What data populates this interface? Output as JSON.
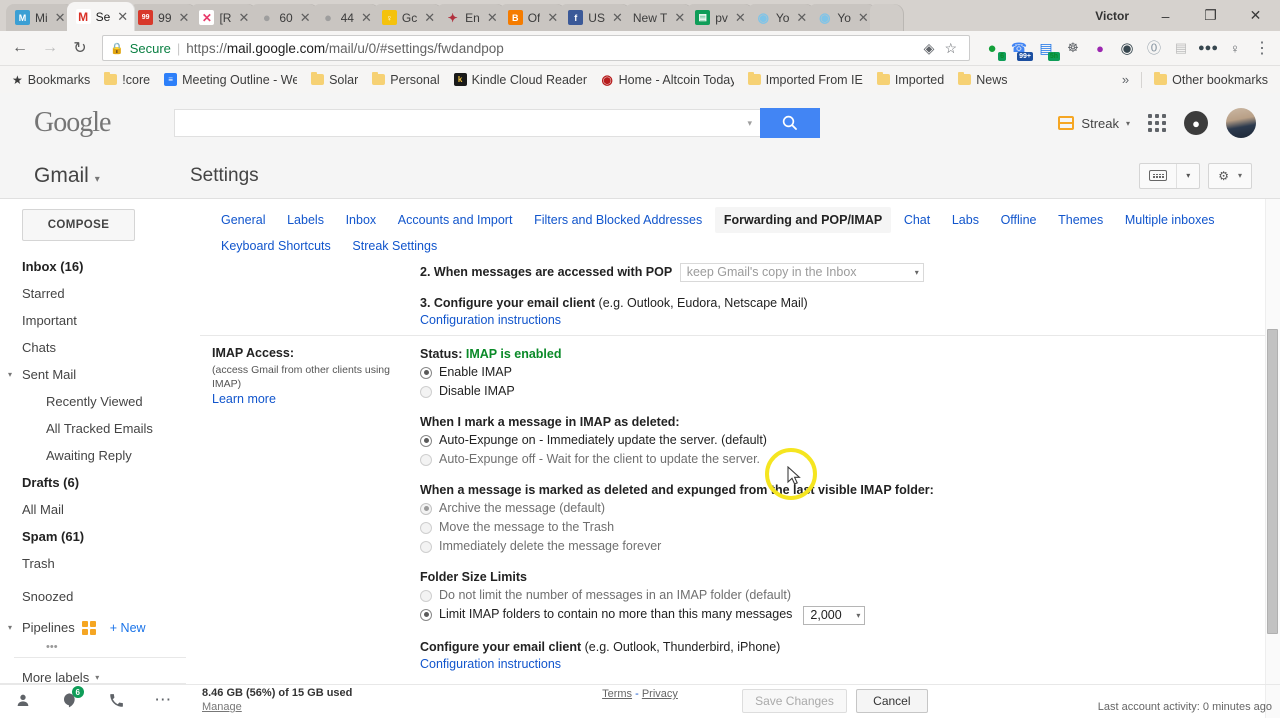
{
  "browser": {
    "tabs": [
      {
        "label": "Mi",
        "fav": "M",
        "favbg": "#3b9fd4",
        "active": false
      },
      {
        "label": "Se",
        "fav": "M",
        "favbg": "#ffffff",
        "favcolor": "#d93025",
        "active": true
      },
      {
        "label": "99",
        "fav": "99",
        "favbg": "#d8392b",
        "active": false
      },
      {
        "label": "[R",
        "fav": "X",
        "favbg": "#ffffff",
        "favcolor": "#e8396a",
        "active": false
      },
      {
        "label": "60",
        "fav": "●",
        "favbg": "#9e9e9e",
        "active": false
      },
      {
        "label": "44",
        "fav": "●",
        "favbg": "#9e9e9e",
        "active": false
      },
      {
        "label": "Gc",
        "fav": "♀",
        "favbg": "#f4c20d",
        "active": false
      },
      {
        "label": "En",
        "fav": "✦",
        "favbg": "#b1303d",
        "active": false
      },
      {
        "label": "Of",
        "fav": "B",
        "favbg": "#f57c00",
        "active": false
      },
      {
        "label": "US",
        "fav": "f",
        "favbg": "#3b5998",
        "active": false
      },
      {
        "label": "New T",
        "fav": "",
        "favbg": "transparent",
        "active": false
      },
      {
        "label": "pv",
        "fav": "▤",
        "favbg": "#0f9d58",
        "active": false
      },
      {
        "label": "Yo",
        "fav": "◉",
        "favbg": "#7fc4e8",
        "active": false
      },
      {
        "label": "Yo",
        "fav": "◉",
        "favbg": "#7fc4e8",
        "active": false
      }
    ],
    "window_user": "Victor",
    "window_minimize": "–",
    "window_maximize": "❐",
    "window_close": "✕",
    "nav": {
      "back_icon": "←",
      "forward_icon": "→",
      "reload_icon": "↻",
      "lock_icon": "🔒",
      "secure_label": "Secure",
      "url_prefix": "https://",
      "url_domain": "mail.google.com",
      "url_path": "/mail/u/0/#settings/fwdandpop",
      "url_full": "https://mail.google.com/mail/u/0/#settings/fwdandpop",
      "cast_icon": "◈",
      "star_icon": "☆",
      "menu_icon": "⋮"
    },
    "extensions": [
      {
        "name": "green-circle-extension",
        "glyph": "●",
        "color": "#14a03a",
        "badge": "6",
        "badgeclass": "green"
      },
      {
        "name": "phone-extension",
        "glyph": "✆",
        "color": "#4285f4",
        "badge": "99+",
        "badgeclass": "dark"
      },
      {
        "name": "blue-note-extension",
        "glyph": "▤",
        "color": "#1a73e8",
        "badge": "5h",
        "badgeclass": "green"
      },
      {
        "name": "swirl-extension",
        "glyph": "@",
        "color": "#5f6368",
        "badge": ""
      },
      {
        "name": "alert-extension",
        "glyph": "●",
        "color": "#9c27b0",
        "badge": ""
      },
      {
        "name": "eye-extension",
        "glyph": "◉",
        "color": "#37474f",
        "badge": ""
      },
      {
        "name": "skype-extension",
        "glyph": "S",
        "color": "#8d9aa5",
        "badge": ""
      },
      {
        "name": "list-extension",
        "glyph": "☰",
        "color": "#b0b0b0",
        "badge": ""
      },
      {
        "name": "dots-extension",
        "glyph": "•••",
        "color": "#37474f",
        "badge": ""
      },
      {
        "name": "bulb-extension",
        "glyph": "♀",
        "color": "#5f6368",
        "badge": ""
      }
    ],
    "bookmarks": {
      "bar_label": "Bookmarks",
      "items": [
        {
          "label": "!core",
          "type": "folder"
        },
        {
          "label": "Meeting Outline - We",
          "type": "icon",
          "glyph": "≡",
          "color": "#2d7ff9"
        },
        {
          "label": "Solar",
          "type": "folder"
        },
        {
          "label": "Personal",
          "type": "folder"
        },
        {
          "label": "Kindle Cloud Reader",
          "type": "icon",
          "glyph": "k",
          "color": "#1a1a1a"
        },
        {
          "label": "Home - Altcoin Today",
          "type": "icon",
          "glyph": "●",
          "color": "#b71c1c"
        },
        {
          "label": "Imported From IE",
          "type": "folder"
        },
        {
          "label": "Imported",
          "type": "folder"
        },
        {
          "label": "News",
          "type": "folder"
        }
      ],
      "overflow_icon": "»",
      "other_label": "Other bookmarks"
    }
  },
  "gmail": {
    "logo": "Google",
    "search_placeholder": "",
    "search_value": "",
    "search_dropdown_icon": "▾",
    "search_button_icon": "ᵌ",
    "streak_label": "Streak",
    "streak_caret": "▾",
    "notifications_icon": "bell",
    "apps_icon": "apps-grid",
    "gmail_menu_label": "Gmail",
    "gmail_menu_caret": "▾",
    "page_title": "Settings",
    "keyboard_button_caret": "▾",
    "gear_icon": "⚙",
    "gear_caret": "▾"
  },
  "sidebar": {
    "compose_label": "COMPOSE",
    "items": [
      {
        "label": "Inbox (16)",
        "bold": true,
        "indent": false
      },
      {
        "label": "Starred",
        "bold": false,
        "indent": false
      },
      {
        "label": "Important",
        "bold": false,
        "indent": false
      },
      {
        "label": "Chats",
        "bold": false,
        "indent": false
      },
      {
        "label": "Sent Mail",
        "bold": false,
        "indent": false,
        "arrow": "▾"
      },
      {
        "label": "Recently Viewed",
        "bold": false,
        "indent": true
      },
      {
        "label": "All Tracked Emails",
        "bold": false,
        "indent": true
      },
      {
        "label": "Awaiting Reply",
        "bold": false,
        "indent": true
      },
      {
        "label": "Drafts (6)",
        "bold": true,
        "indent": false
      },
      {
        "label": "All Mail",
        "bold": false,
        "indent": false
      },
      {
        "label": "Spam (61)",
        "bold": true,
        "indent": false
      },
      {
        "label": "Trash",
        "bold": false,
        "indent": false
      },
      {
        "label": "Snoozed",
        "bold": false,
        "indent": false
      }
    ],
    "pipelines_label": "Pipelines",
    "pipelines_arrow": "▾",
    "pipelines_new": "+ New",
    "more_labels": "More labels",
    "more_labels_caret": "▾",
    "tools": [
      {
        "name": "contacts-icon",
        "glyph": "●",
        "badge": ""
      },
      {
        "name": "hangouts-icon",
        "glyph": "●",
        "badge": "6"
      },
      {
        "name": "phone-icon",
        "glyph": "✆",
        "badge": ""
      },
      {
        "name": "more-icon",
        "glyph": "⋯",
        "badge": ""
      }
    ]
  },
  "settings": {
    "tabs": [
      {
        "label": "General",
        "active": false
      },
      {
        "label": "Labels",
        "active": false
      },
      {
        "label": "Inbox",
        "active": false
      },
      {
        "label": "Accounts and Import",
        "active": false
      },
      {
        "label": "Filters and Blocked Addresses",
        "active": false
      },
      {
        "label": "Forwarding and POP/IMAP",
        "active": true
      },
      {
        "label": "Chat",
        "active": false
      },
      {
        "label": "Labs",
        "active": false
      },
      {
        "label": "Offline",
        "active": false
      },
      {
        "label": "Themes",
        "active": false
      },
      {
        "label": "Multiple inboxes",
        "active": false
      },
      {
        "label": "Keyboard Shortcuts",
        "active": false
      },
      {
        "label": "Streak Settings",
        "active": false
      }
    ],
    "pop": {
      "step2_label": "2. When messages are accessed with POP",
      "step2_select_value": "keep Gmail's copy in the Inbox",
      "step2_select_caret": "▾",
      "step3_label": "3. Configure your email client",
      "step3_note": "(e.g. Outlook, Eudora, Netscape Mail)",
      "step3_link": "Configuration instructions"
    },
    "imap": {
      "heading": "IMAP Access:",
      "subtext": "(access Gmail from other clients using IMAP)",
      "learn_more": "Learn more",
      "status_label": "Status:",
      "status_value": "IMAP is enabled",
      "enable_label": "Enable IMAP",
      "enable_selected": true,
      "disable_label": "Disable IMAP",
      "deleted_heading": "When I mark a message in IMAP as deleted:",
      "deleted_options": [
        {
          "label": "Auto-Expunge on - Immediately update the server. (default)",
          "selected": true
        },
        {
          "label": "Auto-Expunge off - Wait for the client to update the server.",
          "selected": false
        }
      ],
      "expunged_heading": "When a message is marked as deleted and expunged from the last visible IMAP folder:",
      "expunged_options": [
        {
          "label": "Archive the message (default)",
          "selected": true
        },
        {
          "label": "Move the message to the Trash",
          "selected": false
        },
        {
          "label": "Immediately delete the message forever",
          "selected": false
        }
      ],
      "folder_heading": "Folder Size Limits",
      "folder_option_nolimit": "Do not limit the number of messages in an IMAP folder (default)",
      "folder_option_limit": "Limit IMAP folders to contain no more than this many messages",
      "folder_limit_value": "2,000",
      "folder_limit_caret": "▾",
      "configure_label": "Configure your email client",
      "configure_note": "(e.g. Outlook, Thunderbird, iPhone)",
      "configure_link": "Configuration instructions"
    },
    "save_label": "Save Changes",
    "cancel_label": "Cancel"
  },
  "footer": {
    "storage": "8.46 GB (56%) of 15 GB used",
    "manage": "Manage",
    "terms": "Terms",
    "separator": "-",
    "privacy": "Privacy",
    "last_activity": "Last account activity: 0 minutes ago"
  }
}
